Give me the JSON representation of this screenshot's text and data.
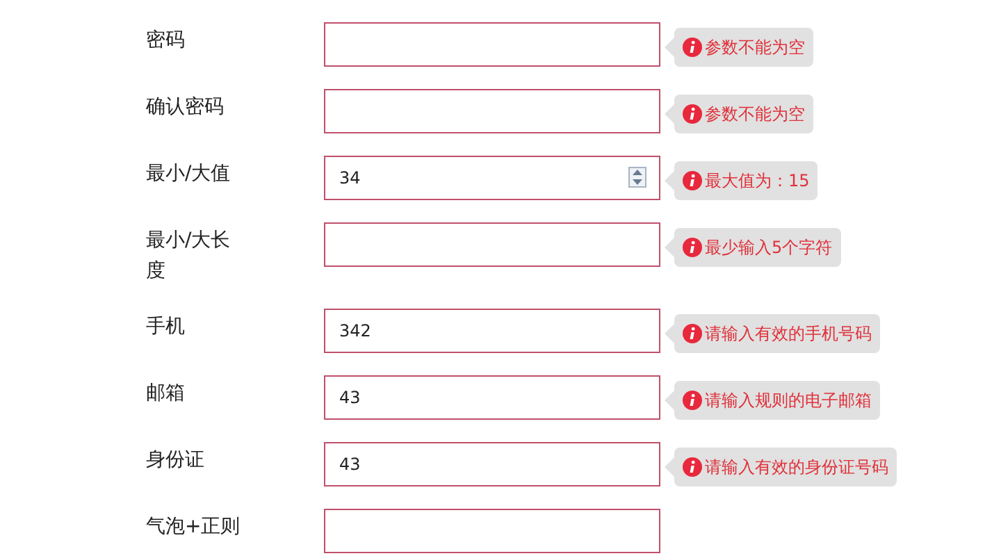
{
  "fields": [
    {
      "label": "密码",
      "kind": "text",
      "error": "参数不能为空"
    },
    {
      "label": "确认密码",
      "kind": "text",
      "error": "参数不能为空"
    },
    {
      "label": "最小/大值",
      "kind": "number",
      "value": "34",
      "error": "最大值为：15"
    },
    {
      "label": "最小/大长度",
      "kind": "text",
      "error": "最少输入5个字符"
    },
    {
      "label": "手机",
      "kind": "text",
      "value": "342",
      "error": "请输入有效的手机号码"
    },
    {
      "label": "邮箱",
      "kind": "text",
      "value": "43",
      "error": "请输入规则的电子邮箱"
    },
    {
      "label": "身份证",
      "kind": "text",
      "value": "43",
      "error": "请输入有效的身份证号码"
    },
    {
      "label": "气泡+正则",
      "kind": "text"
    }
  ]
}
